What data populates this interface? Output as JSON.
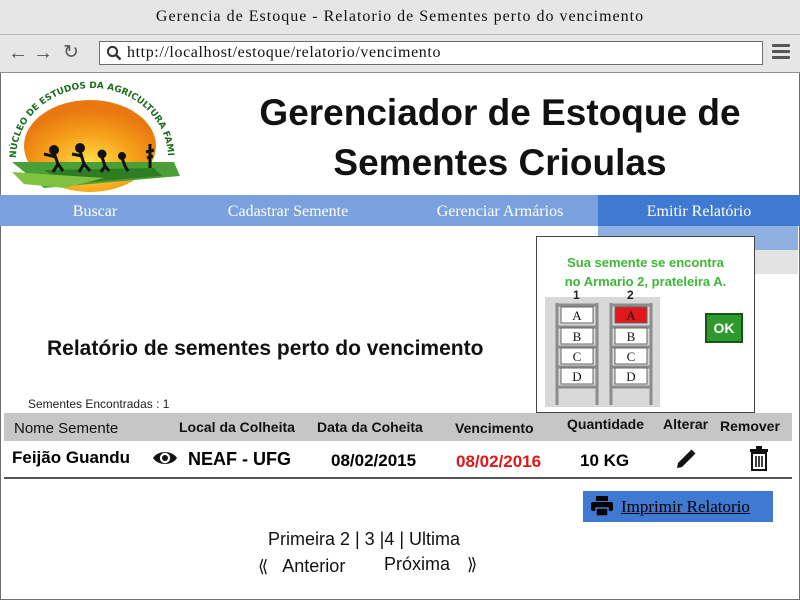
{
  "window": {
    "title": "Gerencia de Estoque - Relatorio de Sementes perto do vencimento"
  },
  "browser": {
    "url": "http://localhost/estoque/relatorio/vencimento"
  },
  "header": {
    "title_line1": "Gerenciador de Estoque de",
    "title_line2": "Sementes Crioulas",
    "logo_text": "NÚCLEO DE ESTUDOS DA AGRICULTURA FAMILIAR"
  },
  "nav": {
    "buscar": "Buscar",
    "cadastrar": "Cadastrar Semente",
    "armarios": "Gerenciar Armários",
    "relatorio": "Emitir Relatório"
  },
  "popup": {
    "line1": "Sua semente se encontra",
    "line2": "no Armario 2, prateleira A.",
    "ok": "OK",
    "cabinets": [
      {
        "number": "1",
        "shelves": [
          "A",
          "B",
          "C",
          "D"
        ]
      },
      {
        "number": "2",
        "shelves": [
          "A",
          "B",
          "C",
          "D"
        ]
      }
    ],
    "highlight": {
      "cabinet": "2",
      "shelf": "A",
      "color": "#e0181b"
    }
  },
  "report": {
    "title": "Relatório de sementes perto do vencimento",
    "found": "Sementes Encontradas : 1"
  },
  "table": {
    "headers": {
      "nome": "Nome Semente",
      "local": "Local da Colheita",
      "data": "Data da Coheita",
      "vencimento": "Vencimento",
      "quantidade": "Quantidade",
      "alterar": "Alterar",
      "remover": "Remover"
    },
    "rows": [
      {
        "nome": "Feijão Guandu",
        "local": "NEAF - UFG",
        "data": "08/02/2015",
        "vencimento": "08/02/2016",
        "quantidade": "10 KG"
      }
    ]
  },
  "print": {
    "label": "Imprimir Relatorio"
  },
  "pagination": {
    "pages": "Primeira 2 | 3 |4 | Ultima",
    "prev": "Anterior",
    "next": "Próxima"
  },
  "colors": {
    "nav_bg": "#7aa1dd",
    "nav_active": "#3f79d2",
    "expired": "#e0181b",
    "popup_text": "#3cb934",
    "ok_bg": "#2e9a2e"
  }
}
